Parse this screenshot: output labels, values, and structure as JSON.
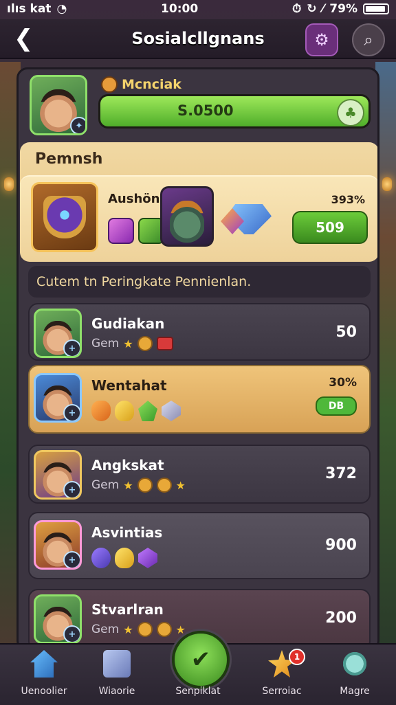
{
  "status_bar": {
    "carrier": "ılıs kat",
    "time": "10:00",
    "battery": "79%"
  },
  "header": {
    "title": "Sosialcllgnans"
  },
  "player": {
    "name": "Mcnciak",
    "xp_text": "S.0500",
    "xp_progress": 1.0
  },
  "featured": {
    "label": "Pemnsh",
    "name": "Aushön",
    "percent": "393%",
    "button_label": "509"
  },
  "section_title": "Cutem tn Peringkate Pennienlan.",
  "rows": [
    {
      "name": "Gudiakan",
      "sub": "Gem",
      "value": "50"
    },
    {
      "name": "Wentahat",
      "sub": "",
      "value": "30%",
      "badge": "DB"
    },
    {
      "name": "Angkskat",
      "sub": "Gem",
      "value": "372"
    },
    {
      "name": "Asvintias",
      "sub": "",
      "value": "900"
    },
    {
      "name": "Stvarlran",
      "sub": "Gem",
      "value": "200"
    }
  ],
  "nav": [
    {
      "label": "Uenoolier",
      "icon": "home-icon"
    },
    {
      "label": "Wiaorie",
      "icon": "box-icon"
    },
    {
      "label": "Senpiklat",
      "icon": "check-icon"
    },
    {
      "label": "Serroiac",
      "icon": "star-icon",
      "notif": "1"
    },
    {
      "label": "Magre",
      "icon": "magnifier-icon"
    }
  ],
  "colors": {
    "accent_green": "#6ccc3a",
    "gold_row": "#efc47a",
    "panel": "#3b3440"
  }
}
